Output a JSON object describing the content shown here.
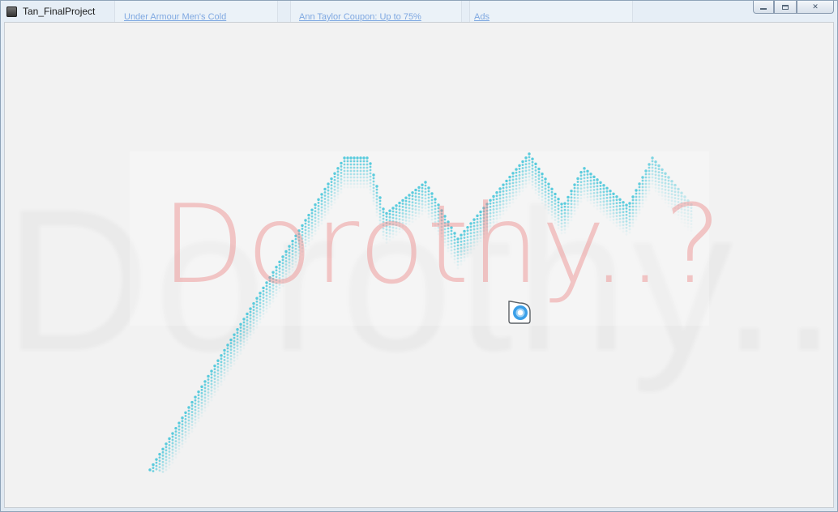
{
  "window": {
    "title": "Tan_FinalProject",
    "icon": "app-icon"
  },
  "controls": {
    "minimize_icon": "minimize-icon",
    "restore_icon": "restore-icon",
    "close_icon": "close-icon",
    "close_glyph": "✕"
  },
  "background_app": {
    "links": [
      "Under Armour Men's Cold",
      "Ann Taylor Coupon: Up to 75%",
      "Ads"
    ]
  },
  "canvas": {
    "heading": "Dorothy..?",
    "ghost_heading": "Dorothy..?",
    "colors": {
      "heading": "#ec8080",
      "dots": "#3cc3d8",
      "cursor": "#3a9fe8",
      "canvas_bg": "#f2f2f2"
    },
    "cursor_icon": "busy-cursor-icon"
  }
}
